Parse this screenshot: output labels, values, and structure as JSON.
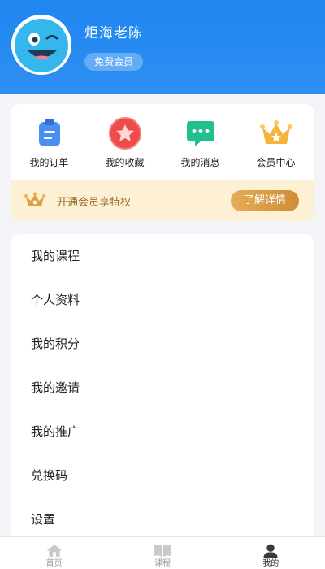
{
  "profile": {
    "username": "炬海老陈",
    "member_badge": "免费会员",
    "avatar_icon": "smiley-face-avatar",
    "header_color": "#2589f0"
  },
  "quick_actions": [
    {
      "label": "我的订单",
      "icon": "clipboard-icon",
      "color": "#4b8df1"
    },
    {
      "label": "我的收藏",
      "icon": "star-icon",
      "color": "#ef4b4b"
    },
    {
      "label": "我的消息",
      "icon": "message-icon",
      "color": "#22c08e"
    },
    {
      "label": "会员中心",
      "icon": "crown-icon",
      "color": "#f2b43c"
    }
  ],
  "vip_banner": {
    "text": "开通会员享特权",
    "button_label": "了解详情",
    "background": "#fdf0d5"
  },
  "menu": {
    "items": [
      {
        "label": "我的课程"
      },
      {
        "label": "个人资料"
      },
      {
        "label": "我的积分"
      },
      {
        "label": "我的邀请"
      },
      {
        "label": "我的推广"
      },
      {
        "label": "兑换码"
      },
      {
        "label": "设置"
      }
    ]
  },
  "tabbar": {
    "items": [
      {
        "label": "首页",
        "icon": "home-icon"
      },
      {
        "label": "课程",
        "icon": "book-icon"
      },
      {
        "label": "我的",
        "icon": "person-icon",
        "active": true
      }
    ]
  }
}
